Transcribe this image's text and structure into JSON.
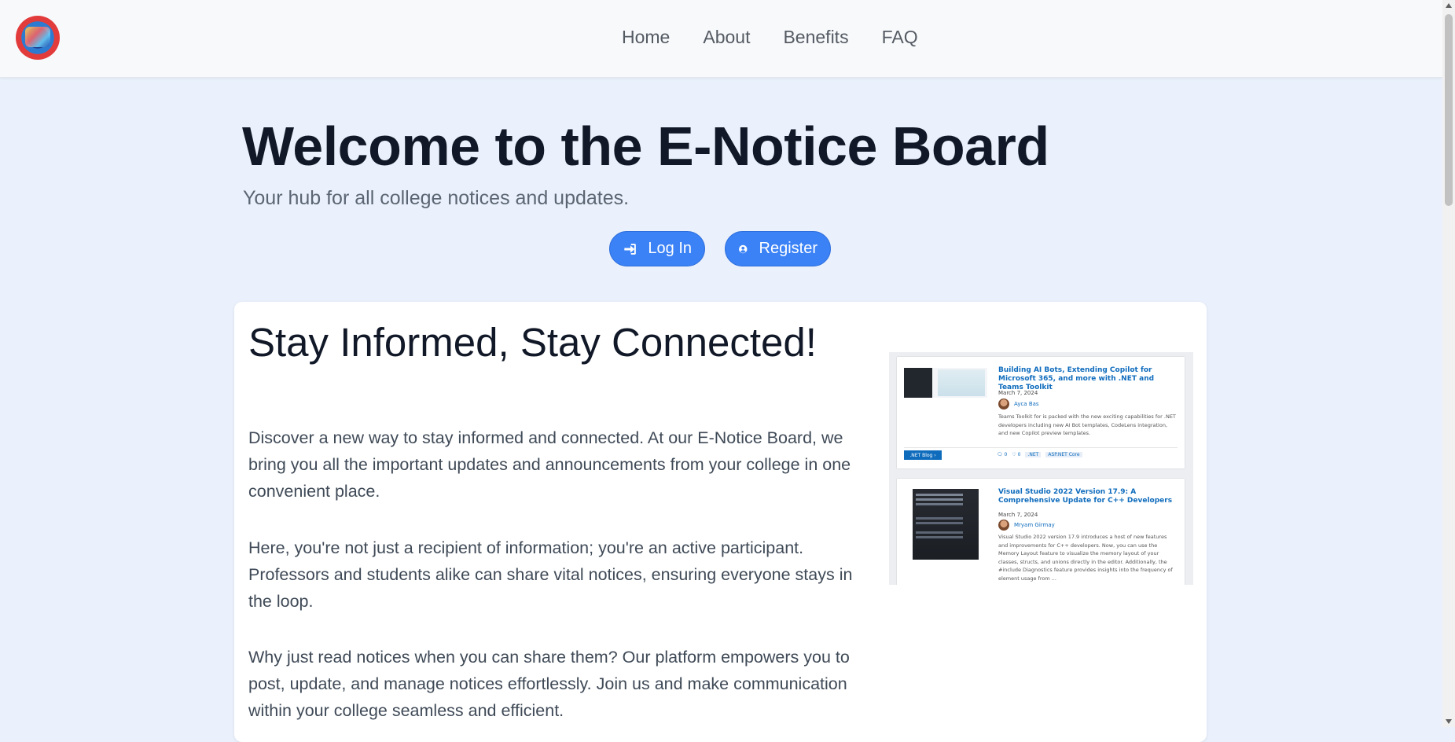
{
  "nav": {
    "links": [
      "Home",
      "About",
      "Benefits",
      "FAQ"
    ]
  },
  "hero": {
    "title": "Welcome to the E-Notice Board",
    "subtitle": "Your hub for all college notices and updates.",
    "login_label": "Log In",
    "register_label": "Register"
  },
  "card": {
    "heading": "Stay Informed, Stay Connected!",
    "paragraphs": [
      "Discover a new way to stay informed and connected. At our E-Notice Board, we bring you all the important updates and announcements from your college in one convenient place.",
      "Here, you're not just a recipient of information; you're an active participant. Professors and students alike can share vital notices, ensuring everyone stays in the loop.",
      "Why just read notices when you can share them? Our platform empowers you to post, update, and manage notices effortlessly. Join us and make communication within your college seamless and efficient."
    ]
  },
  "preview": {
    "posts": [
      {
        "title": "Building AI Bots, Extending Copilot for Microsoft 365, and more with .NET and Teams Toolkit",
        "date": "March 7, 2024",
        "author": "Ayca Bas",
        "text": "Teams Toolkit for is packed with the new exciting capabilities for .NET developers including new AI Bot templates, CodeLens integration, and new Copilot preview templates.",
        "tag": ".NET Blog",
        "comments": "0",
        "likes": "0",
        "chips": [
          ".NET",
          "ASP.NET Core"
        ]
      },
      {
        "title": "Visual Studio 2022 Version 17.9: A Comprehensive Update for C++ Developers",
        "date": "March 7, 2024",
        "author": "Mryam Girmay",
        "text": "Visual Studio 2022 version 17.9 introduces a host of new features and improvements for C++ developers. Now, you can use the Memory Layout feature to visualize the memory layout of your classes, structs, and unions directly in the editor. Additionally, the #include Diagnostics feature provides insights into the frequency of element usage from ..."
      }
    ]
  },
  "colors": {
    "page_bg": "#eaf1fc",
    "primary": "#3b82f6",
    "nav_bg": "#f8f9fb"
  }
}
